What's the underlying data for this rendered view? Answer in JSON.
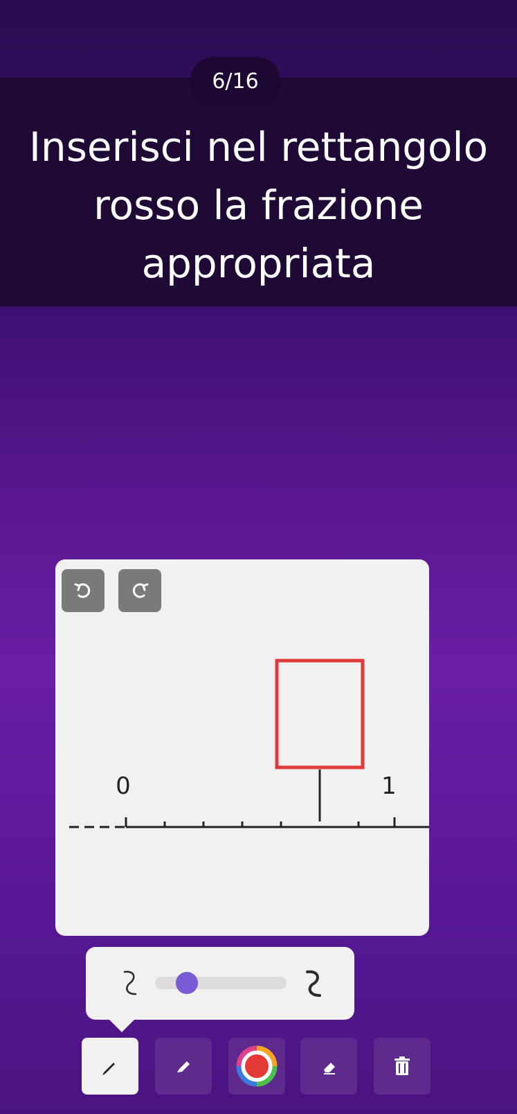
{
  "header": {
    "progress": "6/16"
  },
  "question": {
    "text": "Inserisci nel rettangolo\nrosso la frazione\nappropriata"
  },
  "canvas": {
    "history_icons": [
      "undo-icon",
      "redo-icon"
    ],
    "number_line": {
      "start_label": "0",
      "end_label": "1",
      "answer_box_color": "#e03a3a"
    }
  },
  "brush_size": {
    "icons": [
      "thin-stroke-icon",
      "thick-stroke-icon"
    ],
    "accent": "#7b5ad6"
  },
  "toolbar": {
    "tools": [
      "pencil-icon",
      "marker-icon",
      "color-wheel-icon",
      "eraser-icon",
      "trash-icon"
    ],
    "active_tool": "pencil-icon"
  }
}
